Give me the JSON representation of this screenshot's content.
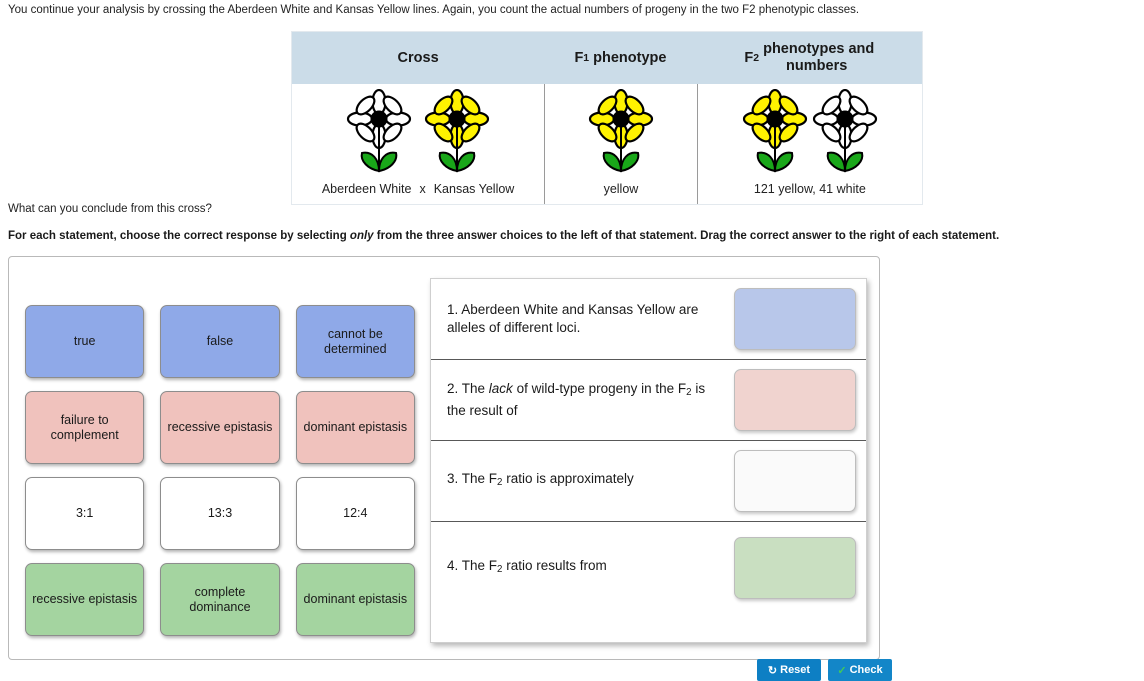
{
  "intro": "You continue your analysis by crossing the Aberdeen White and Kansas Yellow lines. Again, you count the actual numbers of progeny in the two F2 phenotypic classes.",
  "cross_table": {
    "headers": {
      "cross": "Cross",
      "f1": "F₁ phenotype",
      "f2": "F₂ phenotypes and numbers"
    },
    "cross_cell": {
      "parent1_label": "Aberdeen White",
      "cross_symbol": "x",
      "parent2_label": "Kansas Yellow",
      "parent1_color": "white-flower",
      "parent2_color": "yellow-flower"
    },
    "f1_cell": {
      "label": "yellow",
      "flower": "yellow-flower"
    },
    "f2_cell": {
      "label": "121 yellow, 41 white",
      "flower1": "yellow-flower",
      "flower2": "white-flower"
    }
  },
  "question": "What can you conclude from this cross?",
  "instruction_parts": {
    "before": "For each statement, choose the correct response by selecting ",
    "italic": "only",
    "after": " from the three answer choices to the left of that statement. Drag the correct answer to the right of each statement."
  },
  "tiles": [
    [
      {
        "label": "true",
        "color": "blue"
      },
      {
        "label": "false",
        "color": "blue"
      },
      {
        "label": "cannot be determined",
        "color": "blue"
      }
    ],
    [
      {
        "label": "failure to complement",
        "color": "pink"
      },
      {
        "label": "recessive epistasis",
        "color": "pink"
      },
      {
        "label": "dominant epistasis",
        "color": "pink"
      }
    ],
    [
      {
        "label": "3:1",
        "color": "white"
      },
      {
        "label": "13:3",
        "color": "white"
      },
      {
        "label": "12:4",
        "color": "white"
      }
    ],
    [
      {
        "label": "recessive epistasis",
        "color": "green"
      },
      {
        "label": "complete dominance",
        "color": "green"
      },
      {
        "label": "dominant epistasis",
        "color": "green"
      }
    ]
  ],
  "statements": [
    {
      "number": "1.",
      "text": "Aberdeen White and Kansas Yellow are alleles of different loci.",
      "dropzone_color": "blue",
      "dropzone_value": ""
    },
    {
      "number": "2.",
      "text_before": "The ",
      "text_italic": "lack",
      "text_after": " of wild-type progeny in the F₂ is the result of",
      "dropzone_color": "pink",
      "dropzone_value": ""
    },
    {
      "number": "3.",
      "text": "The F₂ ratio is approximately",
      "dropzone_color": "white",
      "dropzone_value": ""
    },
    {
      "number": "4.",
      "text": "The F₂ ratio results from",
      "dropzone_color": "green",
      "dropzone_value": ""
    }
  ],
  "buttons": {
    "reset": "Reset",
    "check": "Check"
  },
  "colors": {
    "table_header_bg": "#cbdce8",
    "tile_blue": "#8fa9e8",
    "tile_pink": "#f0c2bd",
    "tile_white": "#ffffff",
    "tile_green": "#a4d4a0",
    "dropzone_blue": "#b8c7ea",
    "dropzone_pink": "#f0d3cf",
    "dropzone_white": "#fafafa",
    "dropzone_green": "#c9dfc1",
    "flower_yellow": "#fff200",
    "flower_center": "#000000",
    "flower_leaf": "#19a719"
  }
}
